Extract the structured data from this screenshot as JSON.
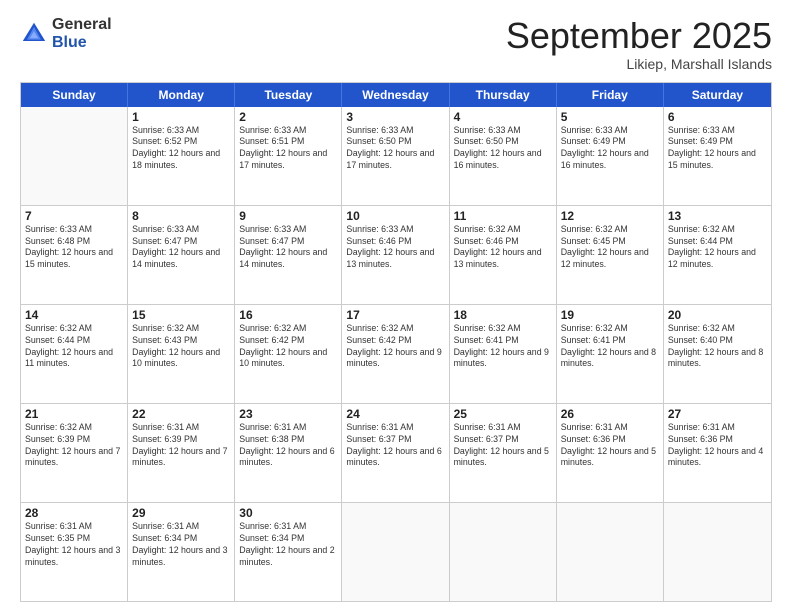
{
  "logo": {
    "general": "General",
    "blue": "Blue"
  },
  "title": "September 2025",
  "location": "Likiep, Marshall Islands",
  "days": [
    "Sunday",
    "Monday",
    "Tuesday",
    "Wednesday",
    "Thursday",
    "Friday",
    "Saturday"
  ],
  "weeks": [
    [
      {
        "day": "",
        "empty": true
      },
      {
        "day": "1",
        "sunrise": "6:33 AM",
        "sunset": "6:52 PM",
        "daylight": "12 hours and 18 minutes."
      },
      {
        "day": "2",
        "sunrise": "6:33 AM",
        "sunset": "6:51 PM",
        "daylight": "12 hours and 17 minutes."
      },
      {
        "day": "3",
        "sunrise": "6:33 AM",
        "sunset": "6:50 PM",
        "daylight": "12 hours and 17 minutes."
      },
      {
        "day": "4",
        "sunrise": "6:33 AM",
        "sunset": "6:50 PM",
        "daylight": "12 hours and 16 minutes."
      },
      {
        "day": "5",
        "sunrise": "6:33 AM",
        "sunset": "6:49 PM",
        "daylight": "12 hours and 16 minutes."
      },
      {
        "day": "6",
        "sunrise": "6:33 AM",
        "sunset": "6:49 PM",
        "daylight": "12 hours and 15 minutes."
      }
    ],
    [
      {
        "day": "7",
        "sunrise": "6:33 AM",
        "sunset": "6:48 PM",
        "daylight": "12 hours and 15 minutes."
      },
      {
        "day": "8",
        "sunrise": "6:33 AM",
        "sunset": "6:47 PM",
        "daylight": "12 hours and 14 minutes."
      },
      {
        "day": "9",
        "sunrise": "6:33 AM",
        "sunset": "6:47 PM",
        "daylight": "12 hours and 14 minutes."
      },
      {
        "day": "10",
        "sunrise": "6:33 AM",
        "sunset": "6:46 PM",
        "daylight": "12 hours and 13 minutes."
      },
      {
        "day": "11",
        "sunrise": "6:32 AM",
        "sunset": "6:46 PM",
        "daylight": "12 hours and 13 minutes."
      },
      {
        "day": "12",
        "sunrise": "6:32 AM",
        "sunset": "6:45 PM",
        "daylight": "12 hours and 12 minutes."
      },
      {
        "day": "13",
        "sunrise": "6:32 AM",
        "sunset": "6:44 PM",
        "daylight": "12 hours and 12 minutes."
      }
    ],
    [
      {
        "day": "14",
        "sunrise": "6:32 AM",
        "sunset": "6:44 PM",
        "daylight": "12 hours and 11 minutes."
      },
      {
        "day": "15",
        "sunrise": "6:32 AM",
        "sunset": "6:43 PM",
        "daylight": "12 hours and 10 minutes."
      },
      {
        "day": "16",
        "sunrise": "6:32 AM",
        "sunset": "6:42 PM",
        "daylight": "12 hours and 10 minutes."
      },
      {
        "day": "17",
        "sunrise": "6:32 AM",
        "sunset": "6:42 PM",
        "daylight": "12 hours and 9 minutes."
      },
      {
        "day": "18",
        "sunrise": "6:32 AM",
        "sunset": "6:41 PM",
        "daylight": "12 hours and 9 minutes."
      },
      {
        "day": "19",
        "sunrise": "6:32 AM",
        "sunset": "6:41 PM",
        "daylight": "12 hours and 8 minutes."
      },
      {
        "day": "20",
        "sunrise": "6:32 AM",
        "sunset": "6:40 PM",
        "daylight": "12 hours and 8 minutes."
      }
    ],
    [
      {
        "day": "21",
        "sunrise": "6:32 AM",
        "sunset": "6:39 PM",
        "daylight": "12 hours and 7 minutes."
      },
      {
        "day": "22",
        "sunrise": "6:31 AM",
        "sunset": "6:39 PM",
        "daylight": "12 hours and 7 minutes."
      },
      {
        "day": "23",
        "sunrise": "6:31 AM",
        "sunset": "6:38 PM",
        "daylight": "12 hours and 6 minutes."
      },
      {
        "day": "24",
        "sunrise": "6:31 AM",
        "sunset": "6:37 PM",
        "daylight": "12 hours and 6 minutes."
      },
      {
        "day": "25",
        "sunrise": "6:31 AM",
        "sunset": "6:37 PM",
        "daylight": "12 hours and 5 minutes."
      },
      {
        "day": "26",
        "sunrise": "6:31 AM",
        "sunset": "6:36 PM",
        "daylight": "12 hours and 5 minutes."
      },
      {
        "day": "27",
        "sunrise": "6:31 AM",
        "sunset": "6:36 PM",
        "daylight": "12 hours and 4 minutes."
      }
    ],
    [
      {
        "day": "28",
        "sunrise": "6:31 AM",
        "sunset": "6:35 PM",
        "daylight": "12 hours and 3 minutes."
      },
      {
        "day": "29",
        "sunrise": "6:31 AM",
        "sunset": "6:34 PM",
        "daylight": "12 hours and 3 minutes."
      },
      {
        "day": "30",
        "sunrise": "6:31 AM",
        "sunset": "6:34 PM",
        "daylight": "12 hours and 2 minutes."
      },
      {
        "day": "",
        "empty": true
      },
      {
        "day": "",
        "empty": true
      },
      {
        "day": "",
        "empty": true
      },
      {
        "day": "",
        "empty": true
      }
    ]
  ]
}
